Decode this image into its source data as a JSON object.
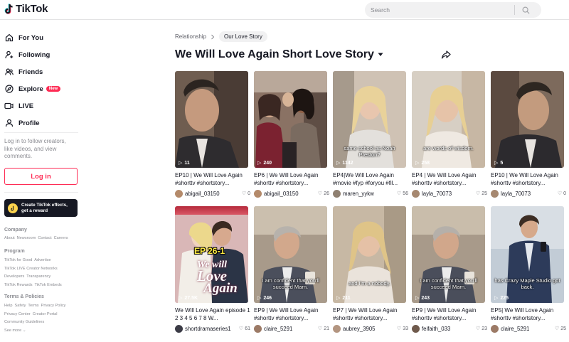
{
  "header": {
    "logo_text": "TikTok",
    "search_placeholder": "Search"
  },
  "sidebar": {
    "nav": [
      {
        "label": "For You",
        "icon": "home-icon"
      },
      {
        "label": "Following",
        "icon": "user-plus-icon"
      },
      {
        "label": "Friends",
        "icon": "friends-icon"
      },
      {
        "label": "Explore",
        "icon": "compass-icon",
        "badge": "New"
      },
      {
        "label": "LIVE",
        "icon": "live-icon"
      },
      {
        "label": "Profile",
        "icon": "profile-icon"
      }
    ],
    "login_prompt": "Log in to follow creators, like videos, and view comments.",
    "login_button": "Log in",
    "effects_label_1": "Create TikTok effects,",
    "effects_label_2": "get a reward",
    "footer": {
      "company_heading": "Company",
      "company_links": [
        "About",
        "Newsroom",
        "Contact",
        "Careers"
      ],
      "program_heading": "Program",
      "program_links": [
        "TikTok for Good",
        "Advertise",
        "TikTok LIVE Creator Networks",
        "Developers",
        "Transparency",
        "TikTok Rewards",
        "TikTok Embeds"
      ],
      "terms_heading": "Terms & Policies",
      "terms_links": [
        "Help",
        "Safety",
        "Terms",
        "Privacy Policy",
        "Privacy Center",
        "Creator Portal",
        "Community Guidelines"
      ],
      "see_more": "See more"
    }
  },
  "main": {
    "breadcrumb_parent": "Relationship",
    "breadcrumb_current": "Our Love Story",
    "title": "We Will Love Again Short Love Story",
    "videos": [
      {
        "plays": "11",
        "title": "EP10 | We Will Love Again #shorttv #shortstory...",
        "author": "abigail_03150",
        "likes": "0",
        "overlay": ""
      },
      {
        "plays": "240",
        "title": "EP6 | We Will Love Again #shorttv #shortstory...",
        "author": "abigail_03150",
        "likes": "26",
        "overlay": ""
      },
      {
        "plays": "1142",
        "title": "EP4|We Will Love Again #movie #fyp #foryou #fil...",
        "author": "maren_yykw",
        "likes": "56",
        "overlay": "same school as Noah Preston?"
      },
      {
        "plays": "258",
        "title": "EP4 | We Will Love Again #shorttv #shortstory...",
        "author": "layla_70073",
        "likes": "25",
        "overlay": "are words of wisdom."
      },
      {
        "plays": "5",
        "title": "EP10 | We Will Love Again #shorttv #shortstory...",
        "author": "layla_70073",
        "likes": "0",
        "overlay": ""
      },
      {
        "plays": "27.5K",
        "title": "We Will Love Again episode 1 2 3 4 5 6 7 8 W...",
        "author": "shortdramaseries1",
        "likes": "61",
        "overlay": "",
        "badge": "EP 26-1",
        "poster_line1": "We will",
        "poster_line2": "Love",
        "poster_line3": "Again"
      },
      {
        "plays": "246",
        "title": "EP9 | We Will Love Again #shorttv #shortstory...",
        "author": "claire_5291",
        "likes": "21",
        "overlay": "I am confident that you'll succeed Marn."
      },
      {
        "plays": "211",
        "title": "EP7 | We Will Love Again #shorttv #shortstory...",
        "author": "aubrey_3905",
        "likes": "33",
        "overlay": "and I'm a nobody."
      },
      {
        "plays": "243",
        "title": "EP9 | We Will Love Again #shorttv #shortstory...",
        "author": "feifaith_033",
        "likes": "23",
        "overlay": "I am confident that you'll succeed Marn."
      },
      {
        "plays": "225",
        "title": "EP5| We Will Love Again #shorttv #shortstory...",
        "author": "claire_5291",
        "likes": "25",
        "overlay": "has Crazy Maple Studio got back."
      }
    ]
  }
}
